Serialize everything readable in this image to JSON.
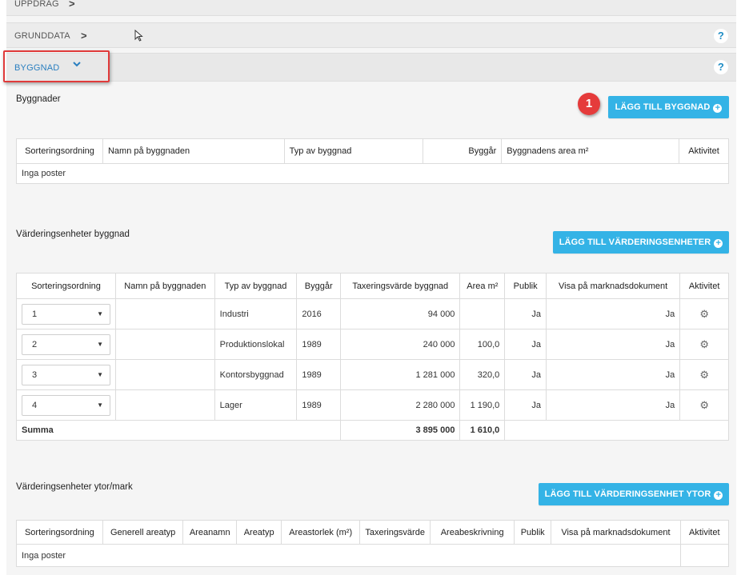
{
  "accordion": {
    "uppdrag_label": "UPPDRAG",
    "grunddata_label": "GRUNDDATA",
    "byggnad_label": "BYGGNAD",
    "help_symbol": "?",
    "chevron_right": ">",
    "chevron_down": "⌄"
  },
  "byggnader": {
    "title": "Byggnader",
    "add_button": "LÄGG TILL BYGGNAD",
    "badge": "1",
    "headers": [
      "Sorteringsordning",
      "Namn på byggnaden",
      "Typ av byggnad",
      "Byggår",
      "Byggnadens area m²",
      "Aktivitet"
    ],
    "empty_text": "Inga poster"
  },
  "varderingsenheter": {
    "title": "Värderingsenheter byggnad",
    "add_button": "LÄGG TILL VÄRDERINGSENHETER",
    "headers": [
      "Sorteringsordning",
      "Namn på byggnaden",
      "Typ av byggnad",
      "Byggår",
      "Taxeringsvärde byggnad",
      "Area m²",
      "Publik",
      "Visa på marknadsdokument",
      "Aktivitet"
    ],
    "rows": [
      {
        "order": "1",
        "name": "",
        "type": "Industri",
        "year": "2016",
        "value": "94 000",
        "area": "",
        "publik": "Ja",
        "visa": "Ja"
      },
      {
        "order": "2",
        "name": "",
        "type": "Produktionslokal",
        "year": "1989",
        "value": "240 000",
        "area": "100,0",
        "publik": "Ja",
        "visa": "Ja"
      },
      {
        "order": "3",
        "name": "",
        "type": "Kontorsbyggnad",
        "year": "1989",
        "value": "1 281 000",
        "area": "320,0",
        "publik": "Ja",
        "visa": "Ja"
      },
      {
        "order": "4",
        "name": "",
        "type": "Lager",
        "year": "1989",
        "value": "2 280 000",
        "area": "1 190,0",
        "publik": "Ja",
        "visa": "Ja"
      }
    ],
    "sum_label": "Summa",
    "sum_value": "3 895 000",
    "sum_area": "1 610,0"
  },
  "ytor": {
    "title": "Värderingsenheter ytor/mark",
    "add_button": "LÄGG TILL VÄRDERINGSENHET YTOR",
    "headers": [
      "Sorteringsordning",
      "Generell areatyp",
      "Areanamn",
      "Areatyp",
      "Areastorlek (m²)",
      "Taxeringsvärde",
      "Areabeskrivning",
      "Publik",
      "Visa på marknadsdokument",
      "Aktivitet"
    ],
    "empty_text": "Inga poster"
  },
  "icons": {
    "gear": "⚙",
    "dropdown_arrow": "▼",
    "plus": "+"
  },
  "colors": {
    "accent_button": "#34b3e6",
    "badge_red": "#e53b3b",
    "highlight_box": "#e03a3a",
    "link_blue": "#2a7fc0"
  }
}
